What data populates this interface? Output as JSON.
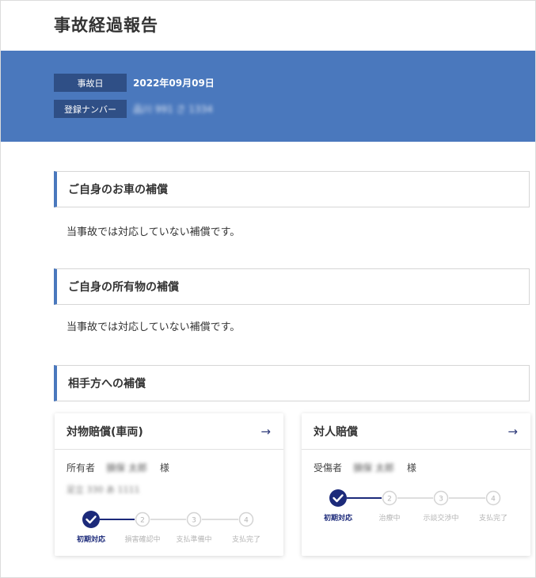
{
  "page": {
    "title": "事故経過報告"
  },
  "info": {
    "accident_date_label": "事故日",
    "accident_date_value": "2022年09月09日",
    "plate_label": "登録ナンバー",
    "plate_value": "品川 991 さ 1334"
  },
  "sections": {
    "own_car": {
      "title": "ご自身のお車の補償",
      "message": "当事故では対応していない補償です。"
    },
    "own_property": {
      "title": "ご自身の所有物の補償",
      "message": "当事故では対応していない補償です。"
    },
    "other_party": {
      "title": "相手方への補償"
    }
  },
  "cards": {
    "property": {
      "title": "対物賠償(車両)",
      "arrow": "→",
      "person_label": "所有者",
      "person_name": "損保 太郎",
      "suffix": "様",
      "plate": "足立 330 あ 1111",
      "steps": [
        {
          "num": "1",
          "label": "初期対応",
          "status": "done"
        },
        {
          "num": "2",
          "label": "損害確認中",
          "status": "pending"
        },
        {
          "num": "3",
          "label": "支払準備中",
          "status": "pending"
        },
        {
          "num": "4",
          "label": "支払完了",
          "status": "pending"
        }
      ]
    },
    "injury": {
      "title": "対人賠償",
      "arrow": "→",
      "person_label": "受傷者",
      "person_name": "損保 太郎",
      "suffix": "様",
      "steps": [
        {
          "num": "1",
          "label": "初期対応",
          "status": "done"
        },
        {
          "num": "2",
          "label": "治療中",
          "status": "pending"
        },
        {
          "num": "3",
          "label": "示談交渉中",
          "status": "pending"
        },
        {
          "num": "4",
          "label": "支払完了",
          "status": "pending"
        }
      ]
    }
  },
  "colors": {
    "band": "#4a78bd",
    "label_bg": "#2f4f86",
    "accent_dark": "#1c2a7a",
    "step_inactive": "#d4d4d4"
  },
  "icons": {
    "done_step": "check-circle-icon",
    "card_link": "arrow-right-icon"
  }
}
